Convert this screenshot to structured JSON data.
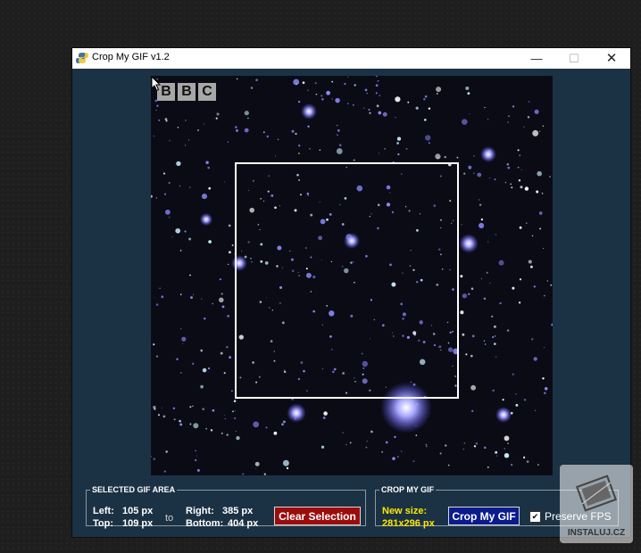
{
  "window": {
    "title": "Crop My GIF v1.2",
    "controls": {
      "minimize": "—",
      "maximize": "☐",
      "close": "✕"
    }
  },
  "canvas": {
    "logo_letters": [
      "B",
      "B",
      "C"
    ],
    "star_seed": 17
  },
  "selected_area": {
    "legend": "SELECTED GIF AREA",
    "left_label": "Left:",
    "left_value": "105 px",
    "top_label": "Top:",
    "top_value": "109 px",
    "to": "to",
    "right_label": "Right:",
    "right_value": "385 px",
    "bottom_label": "Bottom:",
    "bottom_value": "404 px",
    "clear_button": "Clear Selection"
  },
  "crop": {
    "legend": "CROP MY GIF",
    "new_size_label": "New size:",
    "new_size_value": "281x296 px",
    "crop_button": "Crop My GIF",
    "preserve_label": "Preserve FPS",
    "preserve_checked": true
  },
  "watermark": {
    "text": "INSTALUJ.CZ"
  },
  "colors": {
    "window_bg": "#1b3244",
    "clear_button": "#9b0d0d",
    "crop_button": "#0a1b8c",
    "new_size_text": "#ffe600"
  }
}
